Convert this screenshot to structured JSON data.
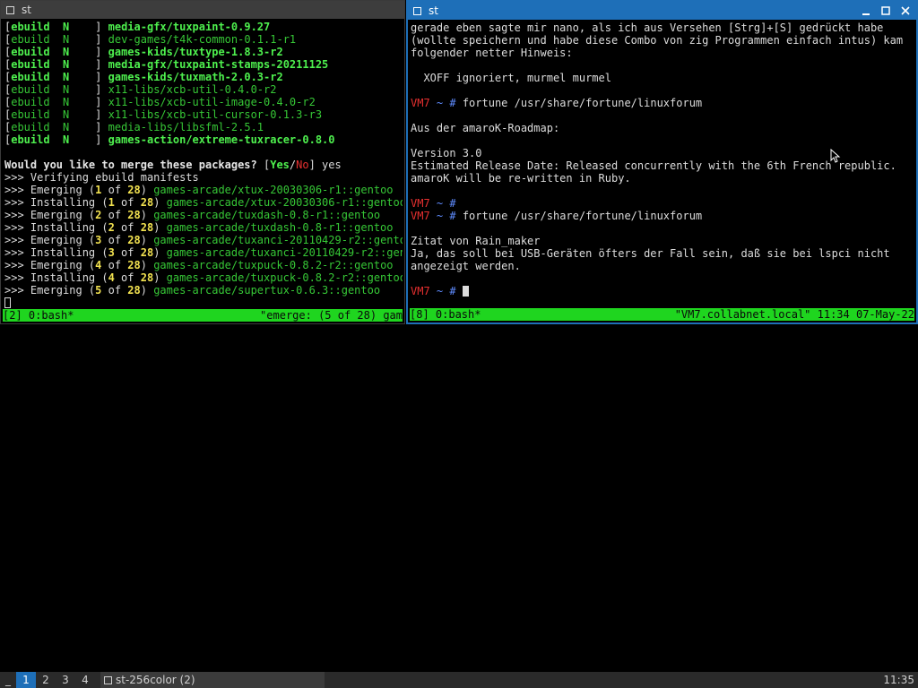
{
  "left_window": {
    "title": "st",
    "lines": [
      {
        "segments": [
          {
            "t": "[",
            "c": ""
          },
          {
            "t": "ebuild  ",
            "c": "gb"
          },
          {
            "t": "N",
            "c": "gb"
          },
          {
            "t": "    ] ",
            "c": ""
          },
          {
            "t": "media-gfx/tuxpaint-0.9.27",
            "c": "gb"
          }
        ]
      },
      {
        "segments": [
          {
            "t": "[",
            "c": ""
          },
          {
            "t": "ebuild  ",
            "c": "g"
          },
          {
            "t": "N",
            "c": "g"
          },
          {
            "t": "    ] ",
            "c": ""
          },
          {
            "t": "dev-games/t4k-common-0.1.1-r1",
            "c": "g"
          }
        ]
      },
      {
        "segments": [
          {
            "t": "[",
            "c": ""
          },
          {
            "t": "ebuild  ",
            "c": "gb"
          },
          {
            "t": "N",
            "c": "gb"
          },
          {
            "t": "    ] ",
            "c": ""
          },
          {
            "t": "games-kids/tuxtype-1.8.3-r2",
            "c": "gb"
          }
        ]
      },
      {
        "segments": [
          {
            "t": "[",
            "c": ""
          },
          {
            "t": "ebuild  ",
            "c": "gb"
          },
          {
            "t": "N",
            "c": "gb"
          },
          {
            "t": "    ] ",
            "c": ""
          },
          {
            "t": "media-gfx/tuxpaint-stamps-20211125",
            "c": "gb"
          }
        ]
      },
      {
        "segments": [
          {
            "t": "[",
            "c": ""
          },
          {
            "t": "ebuild  ",
            "c": "gb"
          },
          {
            "t": "N",
            "c": "gb"
          },
          {
            "t": "    ] ",
            "c": ""
          },
          {
            "t": "games-kids/tuxmath-2.0.3-r2",
            "c": "gb"
          }
        ]
      },
      {
        "segments": [
          {
            "t": "[",
            "c": ""
          },
          {
            "t": "ebuild  ",
            "c": "g"
          },
          {
            "t": "N",
            "c": "g"
          },
          {
            "t": "    ] ",
            "c": ""
          },
          {
            "t": "x11-libs/xcb-util-0.4.0-r2",
            "c": "g"
          }
        ]
      },
      {
        "segments": [
          {
            "t": "[",
            "c": ""
          },
          {
            "t": "ebuild  ",
            "c": "g"
          },
          {
            "t": "N",
            "c": "g"
          },
          {
            "t": "    ] ",
            "c": ""
          },
          {
            "t": "x11-libs/xcb-util-image-0.4.0-r2",
            "c": "g"
          }
        ]
      },
      {
        "segments": [
          {
            "t": "[",
            "c": ""
          },
          {
            "t": "ebuild  ",
            "c": "g"
          },
          {
            "t": "N",
            "c": "g"
          },
          {
            "t": "    ] ",
            "c": ""
          },
          {
            "t": "x11-libs/xcb-util-cursor-0.1.3-r3",
            "c": "g"
          }
        ]
      },
      {
        "segments": [
          {
            "t": "[",
            "c": ""
          },
          {
            "t": "ebuild  ",
            "c": "g"
          },
          {
            "t": "N",
            "c": "g"
          },
          {
            "t": "    ] ",
            "c": ""
          },
          {
            "t": "media-libs/libsfml-2.5.1",
            "c": "g"
          }
        ]
      },
      {
        "segments": [
          {
            "t": "[",
            "c": ""
          },
          {
            "t": "ebuild  ",
            "c": "gb"
          },
          {
            "t": "N",
            "c": "gb"
          },
          {
            "t": "    ] ",
            "c": ""
          },
          {
            "t": "games-action/extreme-tuxracer-0.8.0",
            "c": "gb"
          }
        ]
      },
      {
        "segments": [
          {
            "t": "",
            "c": ""
          }
        ]
      },
      {
        "segments": [
          {
            "t": "Would you like to merge these packages? ",
            "c": "w"
          },
          {
            "t": "[",
            "c": ""
          },
          {
            "t": "Yes",
            "c": "gb"
          },
          {
            "t": "/",
            "c": ""
          },
          {
            "t": "No",
            "c": "r"
          },
          {
            "t": "] yes",
            "c": ""
          }
        ]
      },
      {
        "segments": [
          {
            "t": ">>> Verifying ebuild manifests",
            "c": ""
          }
        ]
      },
      {
        "segments": [
          {
            "t": ">>> Emerging (",
            "c": ""
          },
          {
            "t": "1",
            "c": "y"
          },
          {
            "t": " of ",
            "c": ""
          },
          {
            "t": "28",
            "c": "y"
          },
          {
            "t": ") ",
            "c": ""
          },
          {
            "t": "games-arcade/xtux-20030306-r1::gentoo",
            "c": "g"
          }
        ]
      },
      {
        "segments": [
          {
            "t": ">>> Installing (",
            "c": ""
          },
          {
            "t": "1",
            "c": "y"
          },
          {
            "t": " of ",
            "c": ""
          },
          {
            "t": "28",
            "c": "y"
          },
          {
            "t": ") ",
            "c": ""
          },
          {
            "t": "games-arcade/xtux-20030306-r1::gentoo",
            "c": "g"
          }
        ]
      },
      {
        "segments": [
          {
            "t": ">>> Emerging (",
            "c": ""
          },
          {
            "t": "2",
            "c": "y"
          },
          {
            "t": " of ",
            "c": ""
          },
          {
            "t": "28",
            "c": "y"
          },
          {
            "t": ") ",
            "c": ""
          },
          {
            "t": "games-arcade/tuxdash-0.8-r1::gentoo",
            "c": "g"
          }
        ]
      },
      {
        "segments": [
          {
            "t": ">>> Installing (",
            "c": ""
          },
          {
            "t": "2",
            "c": "y"
          },
          {
            "t": " of ",
            "c": ""
          },
          {
            "t": "28",
            "c": "y"
          },
          {
            "t": ") ",
            "c": ""
          },
          {
            "t": "games-arcade/tuxdash-0.8-r1::gentoo",
            "c": "g"
          }
        ]
      },
      {
        "segments": [
          {
            "t": ">>> Emerging (",
            "c": ""
          },
          {
            "t": "3",
            "c": "y"
          },
          {
            "t": " of ",
            "c": ""
          },
          {
            "t": "28",
            "c": "y"
          },
          {
            "t": ") ",
            "c": ""
          },
          {
            "t": "games-arcade/tuxanci-20110429-r2::gentoo",
            "c": "g"
          }
        ]
      },
      {
        "segments": [
          {
            "t": ">>> Installing (",
            "c": ""
          },
          {
            "t": "3",
            "c": "y"
          },
          {
            "t": " of ",
            "c": ""
          },
          {
            "t": "28",
            "c": "y"
          },
          {
            "t": ") ",
            "c": ""
          },
          {
            "t": "games-arcade/tuxanci-20110429-r2::gento",
            "c": "g"
          }
        ]
      },
      {
        "segments": [
          {
            "t": ">>> Emerging (",
            "c": ""
          },
          {
            "t": "4",
            "c": "y"
          },
          {
            "t": " of ",
            "c": ""
          },
          {
            "t": "28",
            "c": "y"
          },
          {
            "t": ") ",
            "c": ""
          },
          {
            "t": "games-arcade/tuxpuck-0.8.2-r2::gentoo",
            "c": "g"
          }
        ]
      },
      {
        "segments": [
          {
            "t": ">>> Installing (",
            "c": ""
          },
          {
            "t": "4",
            "c": "y"
          },
          {
            "t": " of ",
            "c": ""
          },
          {
            "t": "28",
            "c": "y"
          },
          {
            "t": ") ",
            "c": ""
          },
          {
            "t": "games-arcade/tuxpuck-0.8.2-r2::gentoo",
            "c": "g"
          }
        ]
      },
      {
        "segments": [
          {
            "t": ">>> Emerging (",
            "c": ""
          },
          {
            "t": "5",
            "c": "y"
          },
          {
            "t": " of ",
            "c": ""
          },
          {
            "t": "28",
            "c": "y"
          },
          {
            "t": ") ",
            "c": ""
          },
          {
            "t": "games-arcade/supertux-0.6.3::gentoo",
            "c": "g"
          }
        ]
      },
      {
        "segments": [
          {
            "t": "",
            "c": ""
          }
        ]
      }
    ],
    "status_left": "[2] 0:bash*",
    "status_right": "\"emerge: (5 of 28) gam"
  },
  "right_window": {
    "title": "st",
    "lines": [
      {
        "segments": [
          {
            "t": "gerade eben sagte mir nano, als ich aus Versehen [Strg]+[S] gedrückt habe",
            "c": ""
          }
        ]
      },
      {
        "segments": [
          {
            "t": "(wollte speichern und habe diese Combo von zig Programmen einfach intus) kam",
            "c": ""
          }
        ]
      },
      {
        "segments": [
          {
            "t": "folgender netter Hinweis:",
            "c": ""
          }
        ]
      },
      {
        "segments": [
          {
            "t": "",
            "c": ""
          }
        ]
      },
      {
        "segments": [
          {
            "t": "  XOFF ignoriert, murmel murmel",
            "c": ""
          }
        ]
      },
      {
        "segments": [
          {
            "t": "",
            "c": ""
          }
        ]
      },
      {
        "segments": [
          {
            "t": "VM7",
            "c": "r"
          },
          {
            "t": " ~ ",
            "c": "b"
          },
          {
            "t": "# ",
            "c": "b"
          },
          {
            "t": "fortune /usr/share/fortune/linuxforum",
            "c": ""
          }
        ]
      },
      {
        "segments": [
          {
            "t": "",
            "c": ""
          }
        ]
      },
      {
        "segments": [
          {
            "t": "Aus der amaroK-Roadmap:",
            "c": ""
          }
        ]
      },
      {
        "segments": [
          {
            "t": "",
            "c": ""
          }
        ]
      },
      {
        "segments": [
          {
            "t": "Version 3.0",
            "c": ""
          }
        ]
      },
      {
        "segments": [
          {
            "t": "Estimated Release Date: Released concurrently with the 6th French republic.",
            "c": ""
          }
        ]
      },
      {
        "segments": [
          {
            "t": "amaroK will be re-written in Ruby.",
            "c": ""
          }
        ]
      },
      {
        "segments": [
          {
            "t": "",
            "c": ""
          }
        ]
      },
      {
        "segments": [
          {
            "t": "VM7",
            "c": "r"
          },
          {
            "t": " ~ ",
            "c": "b"
          },
          {
            "t": "# ",
            "c": "b"
          }
        ]
      },
      {
        "segments": [
          {
            "t": "VM7",
            "c": "r"
          },
          {
            "t": " ~ ",
            "c": "b"
          },
          {
            "t": "# ",
            "c": "b"
          },
          {
            "t": "fortune /usr/share/fortune/linuxforum",
            "c": ""
          }
        ]
      },
      {
        "segments": [
          {
            "t": "",
            "c": ""
          }
        ]
      },
      {
        "segments": [
          {
            "t": "Zitat von Rain_maker",
            "c": ""
          }
        ]
      },
      {
        "segments": [
          {
            "t": "Ja, das soll bei USB-Geräten öfters der Fall sein, daß sie bei lspci nicht",
            "c": ""
          }
        ]
      },
      {
        "segments": [
          {
            "t": "angezeigt werden.",
            "c": ""
          }
        ]
      },
      {
        "segments": [
          {
            "t": "",
            "c": ""
          }
        ]
      },
      {
        "segments": [
          {
            "t": "VM7",
            "c": "r"
          },
          {
            "t": " ~ ",
            "c": "b"
          },
          {
            "t": "# ",
            "c": "b"
          }
        ]
      }
    ],
    "status_left": "[8] 0:bash*",
    "status_right": "\"VM7.collabnet.local\" 11:34 07-May-22"
  },
  "taskbar": {
    "layout_symbol": "_",
    "tags": [
      "1",
      "2",
      "3",
      "4"
    ],
    "active_tag": "1",
    "task_label": "st-256color (2)",
    "clock": "11:35"
  }
}
